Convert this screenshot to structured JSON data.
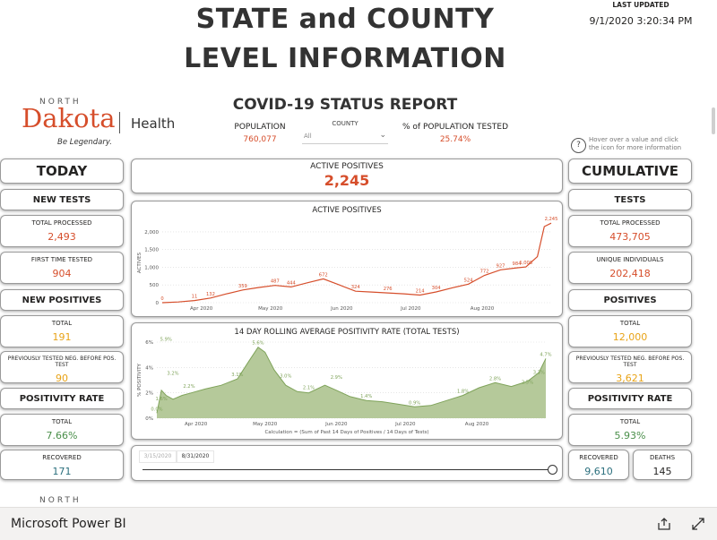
{
  "header": {
    "title_line1": "STATE and COUNTY",
    "title_line2": "LEVEL INFORMATION",
    "last_updated_label": "LAST UPDATED",
    "last_updated_value": "9/1/2020 3:20:34 PM"
  },
  "logo": {
    "north": "NORTH",
    "dakota": "Dakota",
    "health": "Health",
    "tagline": "Be Legendary.",
    "bottom_north": "NORTH"
  },
  "report": {
    "title": "COVID-19 STATUS REPORT",
    "population_label": "POPULATION",
    "population_value": "760,077",
    "county_label": "COUNTY",
    "county_value": "All",
    "tested_label": "% of POPULATION TESTED",
    "tested_value": "25.74%",
    "hover_hint": "Hover over a value and click the icon for more information"
  },
  "today": {
    "title": "TODAY",
    "new_tests": "NEW TESTS",
    "total_processed_label": "TOTAL PROCESSED",
    "total_processed_value": "2,493",
    "first_time_label": "FIRST TIME TESTED",
    "first_time_value": "904",
    "new_positives": "NEW POSITIVES",
    "total_label": "TOTAL",
    "total_value": "191",
    "prev_tested_label": "PREVIOUSLY TESTED NEG. BEFORE POS. TEST",
    "prev_tested_value": "90",
    "positivity_rate": "POSITIVITY RATE",
    "rate_total_label": "TOTAL",
    "rate_total_value": "7.66%",
    "recovered_label": "RECOVERED",
    "recovered_value": "171"
  },
  "active": {
    "label": "ACTIVE POSITIVES",
    "value": "2,245"
  },
  "cumulative": {
    "title": "CUMULATIVE",
    "tests": "TESTS",
    "total_processed_label": "TOTAL PROCESSED",
    "total_processed_value": "473,705",
    "unique_label": "UNIQUE INDIVIDUALS",
    "unique_value": "202,418",
    "positives": "POSITIVES",
    "total_label": "TOTAL",
    "total_value": "12,000",
    "prev_tested_label": "PREVIOUSLY TESTED NEG. BEFORE POS. TEST",
    "prev_tested_value": "3,621",
    "positivity_rate": "POSITIVITY RATE",
    "rate_total_label": "TOTAL",
    "rate_total_value": "5.93%",
    "recovered_label": "RECOVERED",
    "recovered_value": "9,610",
    "deaths_label": "DEATHS",
    "deaths_value": "145"
  },
  "slider": {
    "start": "3/15/2020",
    "end": "8/31/2020"
  },
  "footer": {
    "brand": "Microsoft Power BI"
  },
  "colors": {
    "red": "#d64e2b",
    "green_fill": "#b5c99a",
    "green_line": "#7fa35a",
    "orange": "#e8a317",
    "teal": "#2b6f7d"
  },
  "chart_data": [
    {
      "type": "line",
      "title": "ACTIVE POSITIVES",
      "ylabel": "ACTIVES",
      "ylim": [
        0,
        2250
      ],
      "yticks": [
        "0",
        "500",
        "1,000",
        "1,500",
        "2,000"
      ],
      "ytick_values": [
        0,
        500,
        1000,
        1500,
        2000
      ],
      "xticks": [
        "Apr 2020",
        "May 2020",
        "Jun 2020",
        "Jul 2020",
        "Aug 2020"
      ],
      "xtick_dates": [
        "2020-04-01",
        "2020-05-01",
        "2020-06-01",
        "2020-07-01",
        "2020-08-01"
      ],
      "x_range": [
        "2020-03-15",
        "2020-08-31"
      ],
      "x": [
        "2020-03-15",
        "2020-03-22",
        "2020-03-29",
        "2020-04-05",
        "2020-04-12",
        "2020-04-19",
        "2020-04-26",
        "2020-05-03",
        "2020-05-10",
        "2020-05-17",
        "2020-05-24",
        "2020-05-31",
        "2020-06-07",
        "2020-06-14",
        "2020-06-21",
        "2020-06-28",
        "2020-07-05",
        "2020-07-12",
        "2020-07-19",
        "2020-07-26",
        "2020-08-02",
        "2020-08-09",
        "2020-08-16",
        "2020-08-20",
        "2020-08-25",
        "2020-08-28",
        "2020-08-31"
      ],
      "values": [
        0,
        20,
        60,
        132,
        250,
        359,
        430,
        487,
        444,
        560,
        672,
        500,
        324,
        300,
        276,
        250,
        214,
        304,
        420,
        524,
        772,
        927,
        984,
        1008,
        1300,
        2150,
        2245
      ],
      "data_labels": [
        {
          "x": "2020-03-15",
          "y": 0,
          "text": "0"
        },
        {
          "x": "2020-03-29",
          "y": 60,
          "text": "11"
        },
        {
          "x": "2020-04-05",
          "y": 132,
          "text": "132"
        },
        {
          "x": "2020-04-19",
          "y": 359,
          "text": "359"
        },
        {
          "x": "2020-05-03",
          "y": 487,
          "text": "487"
        },
        {
          "x": "2020-05-10",
          "y": 444,
          "text": "444"
        },
        {
          "x": "2020-05-24",
          "y": 672,
          "text": "672"
        },
        {
          "x": "2020-06-07",
          "y": 324,
          "text": "324"
        },
        {
          "x": "2020-06-21",
          "y": 276,
          "text": "276"
        },
        {
          "x": "2020-07-05",
          "y": 214,
          "text": "214"
        },
        {
          "x": "2020-07-12",
          "y": 304,
          "text": "304"
        },
        {
          "x": "2020-07-26",
          "y": 524,
          "text": "524"
        },
        {
          "x": "2020-08-02",
          "y": 772,
          "text": "772"
        },
        {
          "x": "2020-08-09",
          "y": 927,
          "text": "927"
        },
        {
          "x": "2020-08-16",
          "y": 984,
          "text": "984"
        },
        {
          "x": "2020-08-20",
          "y": 1008,
          "text": "1,008"
        },
        {
          "x": "2020-08-31",
          "y": 2245,
          "text": "2,245"
        }
      ]
    },
    {
      "type": "area",
      "title": "14 DAY ROLLING AVERAGE POSITIVITY RATE (TOTAL TESTS)",
      "ylabel": "% POSITIVITY",
      "xlabel": "Calculation = (Sum of Past 14 Days of Positives / 14 Days of Tests)",
      "ylim": [
        0,
        6
      ],
      "yticks": [
        "0%",
        "2%",
        "4%",
        "6%"
      ],
      "ytick_values": [
        0,
        2,
        4,
        6
      ],
      "xticks": [
        "Apr 2020",
        "May 2020",
        "Jun 2020",
        "Jul 2020",
        "Aug 2020"
      ],
      "xtick_dates": [
        "2020-04-01",
        "2020-05-01",
        "2020-06-01",
        "2020-07-01",
        "2020-08-01"
      ],
      "x_range": [
        "2020-03-15",
        "2020-08-31"
      ],
      "x": [
        "2020-03-15",
        "2020-03-17",
        "2020-03-19",
        "2020-03-22",
        "2020-03-26",
        "2020-03-30",
        "2020-04-05",
        "2020-04-12",
        "2020-04-19",
        "2020-04-24",
        "2020-04-28",
        "2020-05-01",
        "2020-05-05",
        "2020-05-10",
        "2020-05-15",
        "2020-05-20",
        "2020-05-27",
        "2020-06-01",
        "2020-06-07",
        "2020-06-14",
        "2020-06-21",
        "2020-06-28",
        "2020-07-05",
        "2020-07-12",
        "2020-07-19",
        "2020-07-26",
        "2020-08-02",
        "2020-08-09",
        "2020-08-16",
        "2020-08-23",
        "2020-08-28",
        "2020-08-31"
      ],
      "values": [
        0.4,
        2.2,
        1.8,
        1.5,
        1.8,
        2.0,
        2.3,
        2.6,
        3.1,
        4.5,
        5.6,
        5.2,
        3.8,
        2.6,
        2.1,
        2.0,
        2.6,
        2.2,
        1.7,
        1.4,
        1.3,
        1.1,
        0.9,
        1.0,
        1.4,
        1.8,
        2.4,
        2.8,
        2.5,
        2.9,
        3.6,
        4.7
      ],
      "data_labels": [
        {
          "x": "2020-03-15",
          "y": 0.4,
          "text": "0.0%"
        },
        {
          "x": "2020-03-17",
          "y": 1.2,
          "text": "1.6%"
        },
        {
          "x": "2020-03-19",
          "y": 5.9,
          "text": "5.9%"
        },
        {
          "x": "2020-03-22",
          "y": 3.2,
          "text": "3.2%"
        },
        {
          "x": "2020-03-29",
          "y": 2.2,
          "text": "2.2%"
        },
        {
          "x": "2020-04-19",
          "y": 3.1,
          "text": "3.1%"
        },
        {
          "x": "2020-04-28",
          "y": 5.6,
          "text": "5.6%"
        },
        {
          "x": "2020-05-10",
          "y": 3.0,
          "text": "3.0%"
        },
        {
          "x": "2020-05-20",
          "y": 2.1,
          "text": "2.1%"
        },
        {
          "x": "2020-06-01",
          "y": 2.9,
          "text": "2.9%"
        },
        {
          "x": "2020-06-14",
          "y": 1.4,
          "text": "1.4%"
        },
        {
          "x": "2020-07-05",
          "y": 0.9,
          "text": "0.9%"
        },
        {
          "x": "2020-07-26",
          "y": 1.8,
          "text": "1.8%"
        },
        {
          "x": "2020-08-09",
          "y": 2.8,
          "text": "2.8%"
        },
        {
          "x": "2020-08-23",
          "y": 2.5,
          "text": "2.5%"
        },
        {
          "x": "2020-08-28",
          "y": 3.3,
          "text": "3.3%"
        },
        {
          "x": "2020-08-31",
          "y": 4.7,
          "text": "4.7%"
        }
      ]
    }
  ]
}
